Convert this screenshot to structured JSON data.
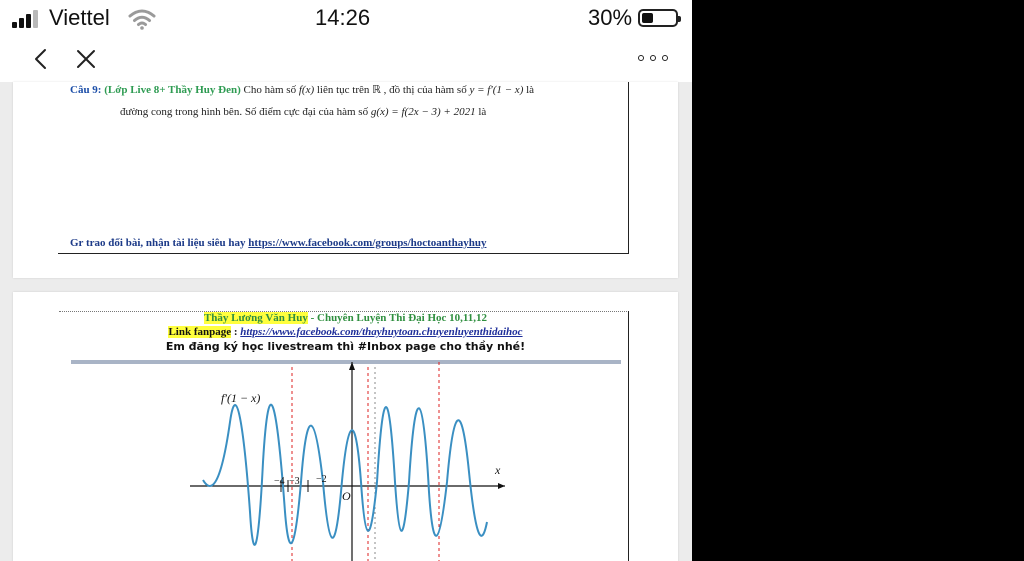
{
  "status_bar": {
    "carrier": "Viettel",
    "time": "14:26",
    "battery_percent": "30%",
    "battery_level": 0.3
  },
  "nav": {
    "back_icon": "chevron-left-icon",
    "close_icon": "close-icon",
    "more_icon": "more-icon"
  },
  "page1": {
    "question_label": "Câu 9:",
    "question_source": "(Lớp Live 8+ Thầy Huy Đen)",
    "line1_a": "Cho hàm số",
    "line1_fx": "f(x)",
    "line1_b": "liên tục trên ℝ , đồ thị của hàm số",
    "line1_y": "y = f′(1 − x)",
    "line1_c": "là",
    "line2_a": "đường cong trong hình bên. Số điểm cực đại của hàm số",
    "line2_g": "g(x) = f(2x − 3) + 2021",
    "line2_b": "là",
    "group_text": "Gr trao đổi bài, nhận tài liệu siêu hay",
    "group_link": "https://www.facebook.com/groups/hoctoanthayhuy"
  },
  "page2": {
    "teacher_name": "Thầy Lương Văn Huy",
    "teacher_rest": "- Chuyên  Luyện Thi  Đại Học 10,11,12",
    "fanpage_label": "Link  fanpage",
    "fanpage_sep": " : ",
    "fanpage_link": "https://www.facebook.com/thayhuytoan.chuyenluyenthidaihoc",
    "promo": "Em đăng ký học livestream thì #Inbox page cho thầy nhé!"
  },
  "graph": {
    "curve_label": "f′(1 − x)",
    "x_label": "x",
    "origin_label": "O",
    "tick_labels": [
      "−4",
      "−3",
      "−2"
    ]
  }
}
